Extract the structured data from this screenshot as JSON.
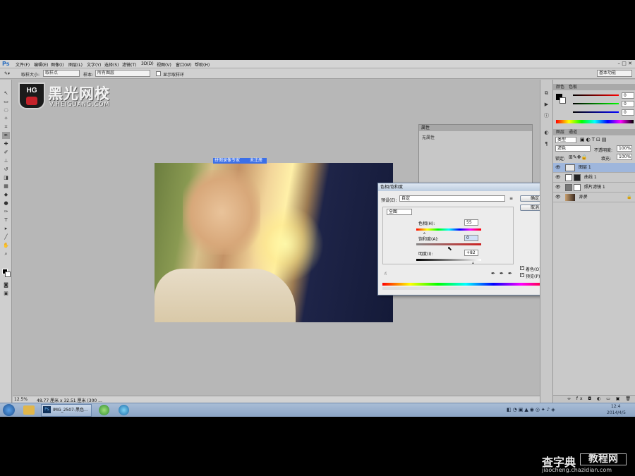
{
  "app": {
    "logo": "Ps"
  },
  "menu": [
    "文件(F)",
    "编辑(E)",
    "图像(I)",
    "图层(L)",
    "文字(Y)",
    "选择(S)",
    "滤镜(T)",
    "3D(D)",
    "视图(V)",
    "窗口(W)",
    "帮助(H)"
  ],
  "options": {
    "size_label": "取样大小:",
    "size_value": "取样点",
    "sample_label": "样本:",
    "sample_value": "所有图层",
    "ring_label": "显示取样环",
    "workspace": "基本功能"
  },
  "logo_watermark": {
    "badge": "HG",
    "name": "黑光网校",
    "url": "V.HEIGUANG.COM"
  },
  "photo": {
    "caption_left": "拼图录像专家",
    "caption_right": "未注册"
  },
  "status": {
    "zoom": "12.5%",
    "doc": "48.77 厘米 x 32.51 厘米 (300 ..."
  },
  "properties_panel": {
    "tab": "属性",
    "body": "无属性"
  },
  "dialog": {
    "title": "色相/饱和度",
    "preset_label": "预设(E):",
    "preset_value": "自定",
    "ok": "确定",
    "cancel": "取消",
    "channel": "全图",
    "hue_label": "色相(H):",
    "hue_value": "55",
    "sat_label": "饱和度(A):",
    "sat_value": "0",
    "light_label": "明度(I):",
    "light_value": "+82",
    "colorize_label": "着色(O)",
    "preview_label": "预览(P)"
  },
  "color_panel": {
    "tab1": "颜色",
    "tab2": "色板",
    "r": "0",
    "g": "0",
    "b": "0"
  },
  "layers_panel": {
    "tab1": "图层",
    "tab2": "通道",
    "kind": "类型",
    "blend": "滤色",
    "opacity_label": "不透明度:",
    "opacity_value": "100%",
    "lock_label": "锁定:",
    "fill_label": "填充:",
    "fill_value": "100%",
    "layers": [
      {
        "name": "图层 1",
        "selected": true
      },
      {
        "name": "曲线 1",
        "selected": false
      },
      {
        "name": "照片滤镜 1",
        "selected": false
      },
      {
        "name": "背景",
        "selected": false
      }
    ]
  },
  "taskbar": {
    "task_label": "IMG_2507-黑色...",
    "time": "12:4",
    "date": "2014/4/5"
  },
  "site_brand": {
    "title_a": "查字典",
    "title_b": "教程网",
    "url": "jiaocheng.chazidian.com"
  }
}
